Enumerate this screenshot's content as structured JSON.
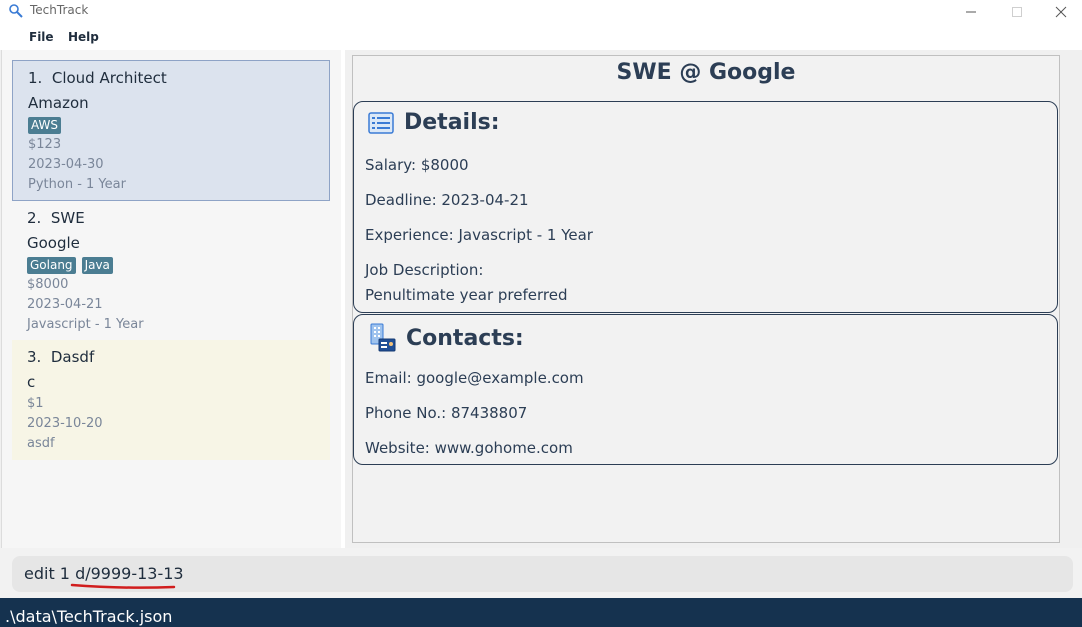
{
  "window": {
    "title": "TechTrack",
    "icon": "magnifier-icon",
    "accent_color": "#15324f"
  },
  "menu": {
    "file": "File",
    "help": "Help"
  },
  "job_list": [
    {
      "index": "1.",
      "role": "Cloud Architect",
      "company": "Amazon",
      "tags": [
        "AWS"
      ],
      "salary": "$123",
      "deadline": "2023-04-30",
      "experience": "Python - 1 Year",
      "selected": true
    },
    {
      "index": "2.",
      "role": "SWE",
      "company": "Google",
      "tags": [
        "Golang",
        "Java"
      ],
      "salary": "$8000",
      "deadline": "2023-04-21",
      "experience": "Javascript - 1 Year"
    },
    {
      "index": "3.",
      "role": "Dasdf",
      "company": "c",
      "tags": [],
      "salary": "$1",
      "deadline": "2023-10-20",
      "experience": "asdf"
    }
  ],
  "detail": {
    "title": "SWE @ Google",
    "details_header": "Details:",
    "salary": "Salary: $8000",
    "deadline": "Deadline: 2023-04-21",
    "experience": "Experience: Javascript - 1 Year",
    "job_description_label": "Job Description:",
    "job_description": "Penultimate year preferred",
    "contacts_header": "Contacts:",
    "email": "Email: google@example.com",
    "phone": "Phone No.: 87438807",
    "website": "Website: www.gohome.com"
  },
  "command": {
    "text": "edit 1 d/9999-13-13"
  },
  "status": {
    "path": ".\\data\\TechTrack.json"
  }
}
